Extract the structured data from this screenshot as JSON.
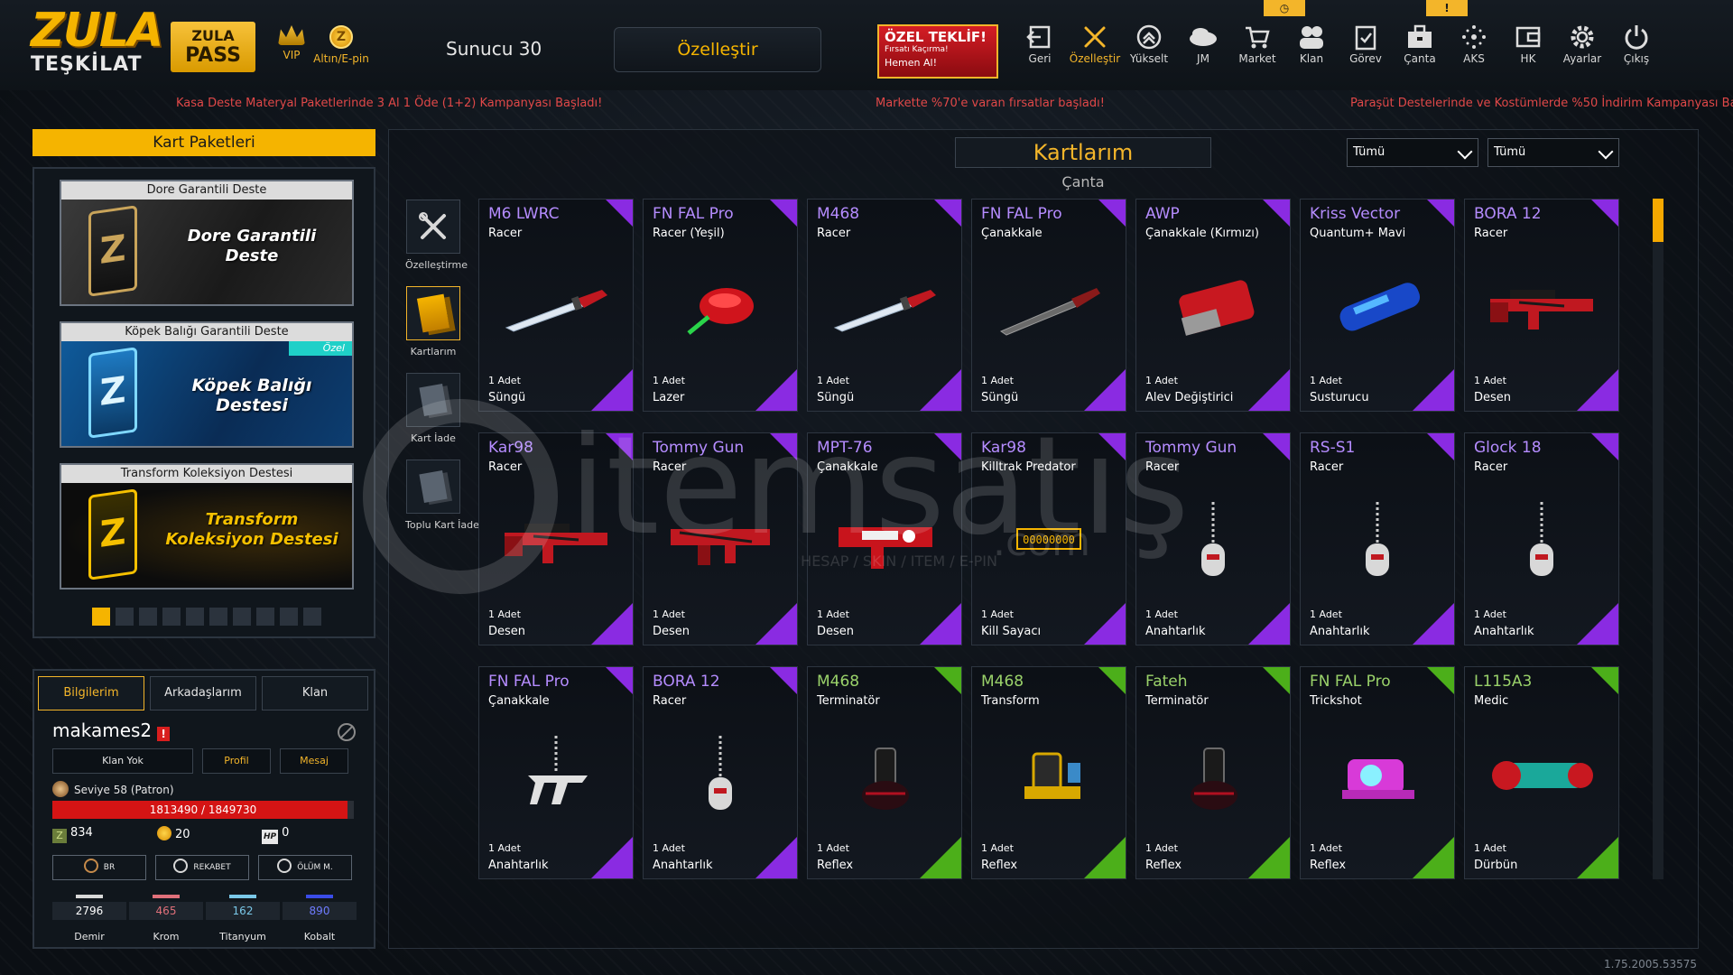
{
  "logo": {
    "line1": "ZULA",
    "line2": "TEŞKİLAT"
  },
  "pass": {
    "line1": "ZULA",
    "line2": "PASS"
  },
  "currency_labels": {
    "vip": "VIP",
    "gold": "Altın/E-pin"
  },
  "server": "Sunucu 30",
  "customize_button": "Özelleştir",
  "offer": {
    "title": "ÖZEL TEKLİF!",
    "subtitle": "Fırsatı Kaçırma!",
    "cta": "Hemen Al!"
  },
  "nav": [
    {
      "label": "Geri",
      "icon": "back-icon"
    },
    {
      "label": "Özelleştir",
      "icon": "tools-icon"
    },
    {
      "label": "Yükselt",
      "icon": "upgrade-icon"
    },
    {
      "label": "JM",
      "icon": "cloud-icon"
    },
    {
      "label": "Market",
      "icon": "cart-icon"
    },
    {
      "label": "Klan",
      "icon": "clan-icon"
    },
    {
      "label": "Görev",
      "icon": "clipboard-icon"
    },
    {
      "label": "Çanta",
      "icon": "bag-icon"
    },
    {
      "label": "AKS",
      "icon": "network-icon"
    },
    {
      "label": "HK",
      "icon": "wallet-icon"
    },
    {
      "label": "Ayarlar",
      "icon": "gear-icon"
    },
    {
      "label": "Çıkış",
      "icon": "power-icon"
    }
  ],
  "nav_badges": {
    "market": "◷",
    "canta": "!"
  },
  "ticker": [
    "Kasa Deste Materyal Paketlerinde 3 Al 1 Öde (1+2) Kampanyası Başladı!",
    "Markette %70'e varan fırsatlar başladı!",
    "Paraşüt Destelerinde ve Kostümlerde %50 İndirim Kampanyası Ba"
  ],
  "card_packs": {
    "title": "Kart Paketleri",
    "decks": [
      {
        "header": "Dore Garantili Deste",
        "text": "Dore Garantili Deste",
        "tag": ""
      },
      {
        "header": "Köpek Balığı Garantili Deste",
        "text": "Köpek Balığı Destesi",
        "tag": "Özel"
      },
      {
        "header": "Transform Koleksiyon Destesi",
        "text": "Transform Koleksiyon Destesi",
        "tag": ""
      }
    ],
    "pages": 10,
    "active_page": 0
  },
  "profile": {
    "tabs": [
      "Bilgilerim",
      "Arkadaşlarım",
      "Klan"
    ],
    "username": "makames2",
    "buttons": [
      "Klan Yok",
      "Profil",
      "Mesaj"
    ],
    "level": "Seviye 58 (Patron)",
    "xp": "1813490 / 1849730",
    "xp_fraction": 0.98,
    "z_points": "834",
    "gold": "20",
    "hp_label": "HP",
    "hp": "0",
    "ranked": [
      "BR",
      "REKABET",
      "ÖLÜM M."
    ],
    "materials": [
      {
        "name": "Demir",
        "value": "2796",
        "color": "#d8d8d8"
      },
      {
        "name": "Krom",
        "value": "465",
        "color": "#e0707a"
      },
      {
        "name": "Titanyum",
        "value": "162",
        "color": "#7ac8e8"
      },
      {
        "name": "Kobalt",
        "value": "890",
        "color": "#3a4ce8"
      }
    ]
  },
  "main": {
    "title": "Kartlarım",
    "subtitle": "Çanta",
    "filter1": "Tümü",
    "filter2": "Tümü",
    "tools": [
      "Özelleştirme",
      "Kartlarım",
      "Kart İade",
      "Toplu Kart İade"
    ]
  },
  "colors": {
    "purple": "#8a2be2",
    "green": "#4caf1a",
    "accent": "#f5b400"
  },
  "cards": [
    {
      "weapon": "M6 LWRC",
      "skin": "Racer",
      "qty": "1 Adet",
      "type": "Süngü",
      "rarity": "purple",
      "art": "knife"
    },
    {
      "weapon": "FN FAL Pro",
      "skin": "Racer (Yeşil)",
      "qty": "1 Adet",
      "type": "Lazer",
      "rarity": "purple",
      "art": "laser"
    },
    {
      "weapon": "M468",
      "skin": "Racer",
      "qty": "1 Adet",
      "type": "Süngü",
      "rarity": "purple",
      "art": "knife"
    },
    {
      "weapon": "FN FAL Pro",
      "skin": "Çanakkale",
      "qty": "1 Adet",
      "type": "Süngü",
      "rarity": "purple",
      "art": "knife-dark"
    },
    {
      "weapon": "AWP",
      "skin": "Çanakkale (Kırmızı)",
      "qty": "1 Adet",
      "type": "Alev Değiştirici",
      "rarity": "purple",
      "art": "muzzle"
    },
    {
      "weapon": "Kriss Vector",
      "skin": "Quantum+ Mavi",
      "qty": "1 Adet",
      "type": "Susturucu",
      "rarity": "purple",
      "art": "suppressor"
    },
    {
      "weapon": "BORA 12",
      "skin": "Racer",
      "qty": "1 Adet",
      "type": "Desen",
      "rarity": "purple",
      "art": "rifle"
    },
    {
      "weapon": "Kar98",
      "skin": "Racer",
      "qty": "1 Adet",
      "type": "Desen",
      "rarity": "purple",
      "art": "rifle"
    },
    {
      "weapon": "Tommy Gun",
      "skin": "Racer",
      "qty": "1 Adet",
      "type": "Desen",
      "rarity": "purple",
      "art": "smg"
    },
    {
      "weapon": "MPT-76",
      "skin": "Çanakkale",
      "qty": "1 Adet",
      "type": "Desen",
      "rarity": "purple",
      "art": "smg-white"
    },
    {
      "weapon": "Kar98",
      "skin": "Killtrak Predator",
      "qty": "1 Adet",
      "type": "Kill Sayacı",
      "rarity": "purple",
      "art": "counter",
      "counter_text": "00000000"
    },
    {
      "weapon": "Tommy Gun",
      "skin": "Racer",
      "qty": "1 Adet",
      "type": "Anahtarlık",
      "rarity": "purple",
      "art": "tag"
    },
    {
      "weapon": "RS-S1",
      "skin": "Racer",
      "qty": "1 Adet",
      "type": "Anahtarlık",
      "rarity": "purple",
      "art": "tag"
    },
    {
      "weapon": "Glock 18",
      "skin": "Racer",
      "qty": "1 Adet",
      "type": "Anahtarlık",
      "rarity": "purple",
      "art": "tag"
    },
    {
      "weapon": "FN FAL Pro",
      "skin": "Çanakkale",
      "qty": "1 Adet",
      "type": "Anahtarlık",
      "rarity": "purple",
      "art": "tag-tr"
    },
    {
      "weapon": "BORA 12",
      "skin": "Racer",
      "qty": "1 Adet",
      "type": "Anahtarlık",
      "rarity": "purple",
      "art": "tag"
    },
    {
      "weapon": "M468",
      "skin": "Terminatör",
      "qty": "1 Adet",
      "type": "Reflex",
      "rarity": "green",
      "art": "reflex-dark"
    },
    {
      "weapon": "M468",
      "skin": "Transform",
      "qty": "1 Adet",
      "type": "Reflex",
      "rarity": "green",
      "art": "reflex-gold"
    },
    {
      "weapon": "Fateh",
      "skin": "Terminatör",
      "qty": "1 Adet",
      "type": "Reflex",
      "rarity": "green",
      "art": "reflex-dark"
    },
    {
      "weapon": "FN FAL Pro",
      "skin": "Trickshot",
      "qty": "1 Adet",
      "type": "Reflex",
      "rarity": "green",
      "art": "reflex-pink"
    },
    {
      "weapon": "L115A3",
      "skin": "Medic",
      "qty": "1 Adet",
      "type": "Dürbün",
      "rarity": "green",
      "art": "scope"
    }
  ],
  "watermark": {
    "brand": "itemsatış",
    "tagline": "HESAP / SKIN / ITEM / E-PIN",
    "suffix": ".com"
  },
  "version": "1.75.2005.53575"
}
